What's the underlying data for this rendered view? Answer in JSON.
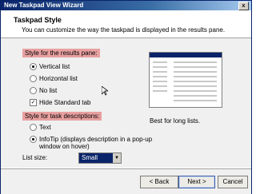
{
  "window": {
    "title": "New Taskpad View Wizard",
    "close_glyph": "x"
  },
  "header": {
    "title": "Taskpad Style",
    "subtitle": "You can customize the way the taskpad is displayed in the results pane."
  },
  "results_pane": {
    "label": "Style for the results pane:",
    "options": [
      "Vertical list",
      "Horizontal list",
      "No list"
    ],
    "selected_index": 0,
    "hide_standard_tab_label": "Hide Standard tab",
    "hide_standard_tab_checked": true
  },
  "task_descriptions": {
    "label": "Style for task descriptions:",
    "text_option": "Text",
    "infotip_option_line1": "InfoTip (displays description in a pop-up",
    "infotip_option_line2": "window on hover)",
    "selected": "InfoTip"
  },
  "list_size": {
    "label": "List size:",
    "value": "Small"
  },
  "preview": {
    "caption": "Best for long lists."
  },
  "buttons": {
    "back": "< Back",
    "next": "Next >",
    "cancel": "Cancel"
  },
  "colors": {
    "highlight": "#e8a0a0",
    "titlebar": "#0a246a",
    "select_bg": "#0a246a"
  },
  "icons": {
    "close": "close-icon",
    "dropdown": "chevron-down-icon",
    "cursor": "mouse-pointer-icon"
  }
}
